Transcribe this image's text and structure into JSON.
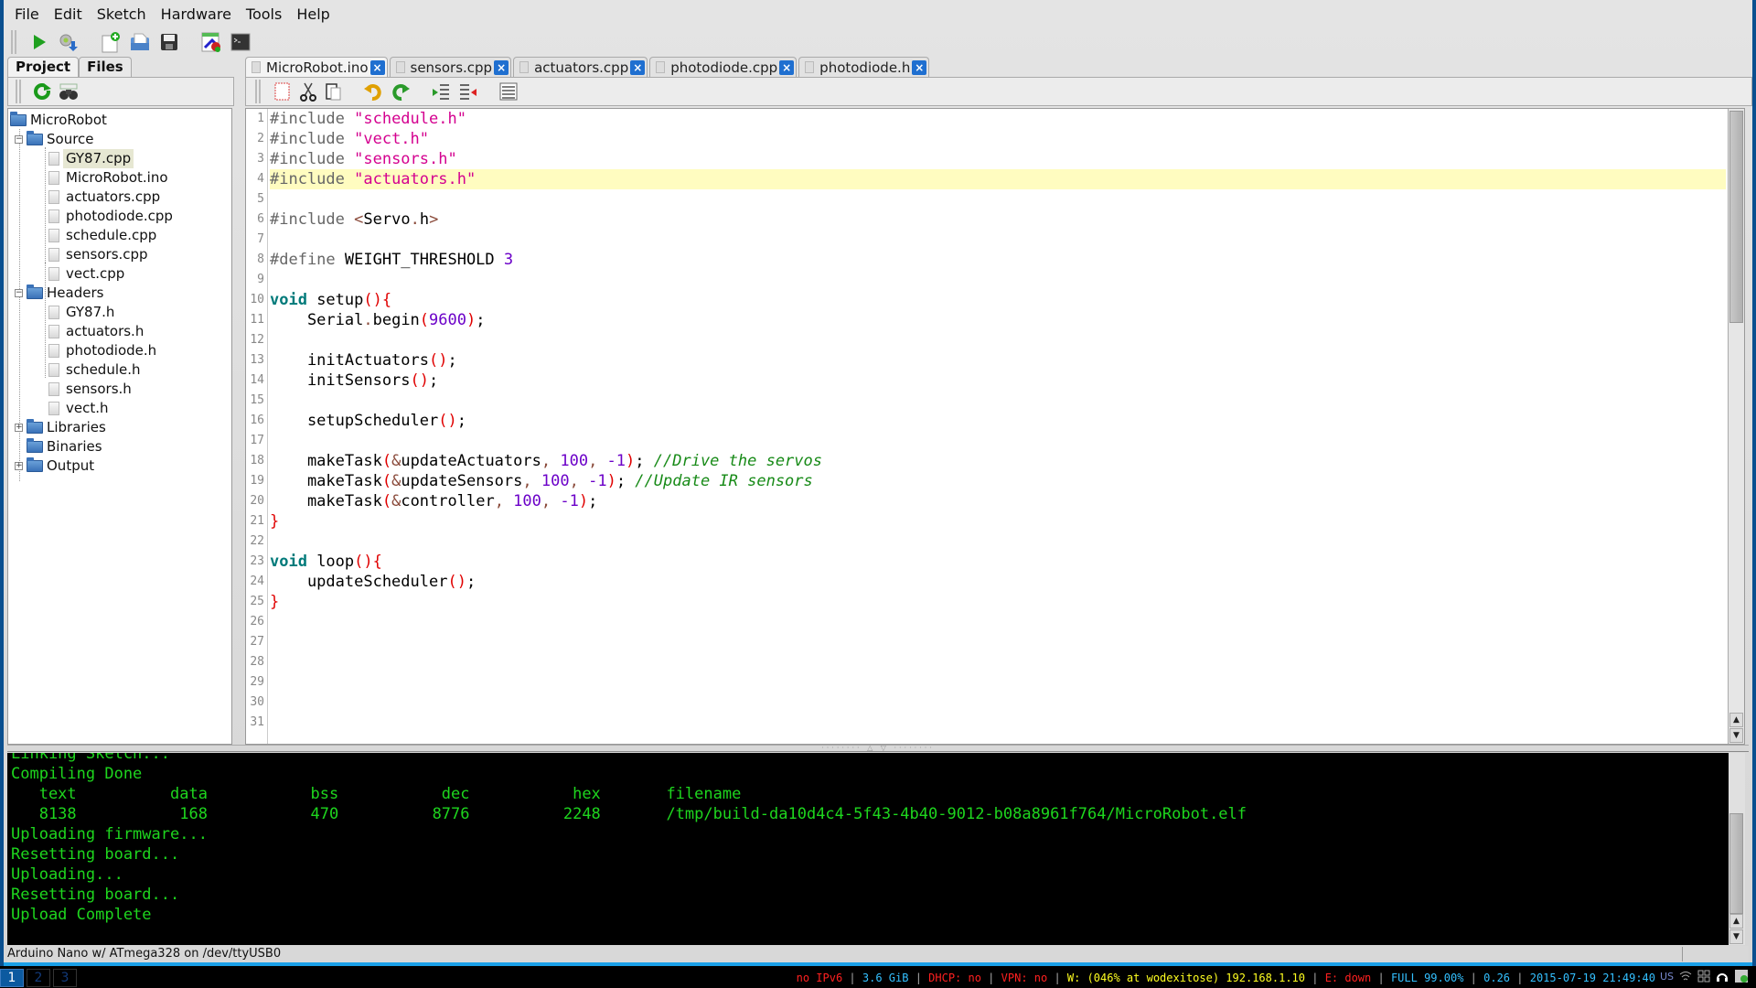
{
  "menu": [
    "File",
    "Edit",
    "Sketch",
    "Hardware",
    "Tools",
    "Help"
  ],
  "toolbar": {
    "icons": [
      "run-icon",
      "upload-icon",
      "new-file-icon",
      "open-folder-icon",
      "save-icon",
      "serial-plotter-icon",
      "terminal-icon"
    ]
  },
  "left_panel": {
    "tabs": [
      "Project",
      "Files"
    ],
    "active_tab": "Project",
    "tree": {
      "root": "MicroRobot",
      "source_label": "Source",
      "source_files": [
        "GY87.cpp",
        "MicroRobot.ino",
        "actuators.cpp",
        "photodiode.cpp",
        "schedule.cpp",
        "sensors.cpp",
        "vect.cpp"
      ],
      "selected": "GY87.cpp",
      "headers_label": "Headers",
      "header_files": [
        "GY87.h",
        "actuators.h",
        "photodiode.h",
        "schedule.h",
        "sensors.h",
        "vect.h"
      ],
      "libraries_label": "Libraries",
      "binaries_label": "Binaries",
      "output_label": "Output"
    }
  },
  "editor": {
    "tabs": [
      "MicroRobot.ino",
      "sensors.cpp",
      "actuators.cpp",
      "photodiode.cpp",
      "photodiode.h"
    ],
    "active_tab": "MicroRobot.ino",
    "highlighted_line": 4,
    "line_count": 31,
    "lines": [
      [
        [
          "pp",
          "#include "
        ],
        [
          "str",
          "\"schedule.h\""
        ]
      ],
      [
        [
          "pp",
          "#include "
        ],
        [
          "str",
          "\"vect.h\""
        ]
      ],
      [
        [
          "pp",
          "#include "
        ],
        [
          "str",
          "\"sensors.h\""
        ]
      ],
      [
        [
          "pp",
          "#include "
        ],
        [
          "str",
          "\"actuators.h\""
        ]
      ],
      [],
      [
        [
          "pp",
          "#include "
        ],
        [
          "ang",
          "<"
        ],
        [
          "",
          "Servo"
        ],
        [
          "ang",
          "."
        ],
        [
          "",
          "h"
        ],
        [
          "ang",
          ">"
        ]
      ],
      [],
      [
        [
          "pp",
          "#define "
        ],
        [
          "",
          "WEIGHT_THRESHOLD "
        ],
        [
          "num",
          "3"
        ]
      ],
      [],
      [
        [
          "kw",
          "void"
        ],
        [
          "",
          " setup"
        ],
        [
          "par",
          "(){"
        ]
      ],
      [
        [
          "",
          "    Serial"
        ],
        [
          "amp",
          "."
        ],
        [
          "",
          "begin"
        ],
        [
          "par",
          "("
        ],
        [
          "num",
          "9600"
        ],
        [
          "par",
          ")"
        ],
        [
          "",
          ";"
        ]
      ],
      [],
      [
        [
          "",
          "    initActuators"
        ],
        [
          "par",
          "()"
        ],
        [
          "",
          ";"
        ]
      ],
      [
        [
          "",
          "    initSensors"
        ],
        [
          "par",
          "()"
        ],
        [
          "",
          ";"
        ]
      ],
      [],
      [
        [
          "",
          "    setupScheduler"
        ],
        [
          "par",
          "()"
        ],
        [
          "",
          ";"
        ]
      ],
      [],
      [
        [
          "",
          "    makeTask"
        ],
        [
          "par",
          "("
        ],
        [
          "amp",
          "&"
        ],
        [
          "",
          "updateActuators"
        ],
        [
          "amp",
          ", "
        ],
        [
          "num",
          "100"
        ],
        [
          "amp",
          ", "
        ],
        [
          "num",
          "-1"
        ],
        [
          "par",
          ")"
        ],
        [
          "",
          "; "
        ],
        [
          "cm",
          "//Drive the servos"
        ]
      ],
      [
        [
          "",
          "    makeTask"
        ],
        [
          "par",
          "("
        ],
        [
          "amp",
          "&"
        ],
        [
          "",
          "updateSensors"
        ],
        [
          "amp",
          ", "
        ],
        [
          "num",
          "100"
        ],
        [
          "amp",
          ", "
        ],
        [
          "num",
          "-1"
        ],
        [
          "par",
          ")"
        ],
        [
          "",
          "; "
        ],
        [
          "cm",
          "//Update IR sensors"
        ]
      ],
      [
        [
          "",
          "    makeTask"
        ],
        [
          "par",
          "("
        ],
        [
          "amp",
          "&"
        ],
        [
          "",
          "controller"
        ],
        [
          "amp",
          ", "
        ],
        [
          "num",
          "100"
        ],
        [
          "amp",
          ", "
        ],
        [
          "num",
          "-1"
        ],
        [
          "par",
          ")"
        ],
        [
          "",
          ";"
        ]
      ],
      [
        [
          "par",
          "}"
        ]
      ],
      [],
      [
        [
          "kw",
          "void"
        ],
        [
          "",
          " loop"
        ],
        [
          "par",
          "(){"
        ]
      ],
      [
        [
          "",
          "    updateScheduler"
        ],
        [
          "par",
          "()"
        ],
        [
          "",
          ";"
        ]
      ],
      [
        [
          "par",
          "}"
        ]
      ],
      [],
      [],
      [],
      [],
      [],
      []
    ]
  },
  "console": {
    "partial_top": "Linking Sketch...",
    "lines": [
      "Compiling Done",
      "   text          data           bss           dec           hex       filename",
      "   8138           168           470          8776          2248       /tmp/build-da10d4c4-5f43-4b40-9012-b08a8961f764/MicroRobot.elf",
      "Uploading firmware...",
      "Resetting board...",
      "Uploading...",
      "Resetting board...",
      "Upload Complete"
    ]
  },
  "status_bar": "Arduino Nano w/ ATmega328 on /dev/ttyUSB0",
  "taskbar": {
    "workspaces": [
      "1",
      "2",
      "3"
    ],
    "active_workspace": "1",
    "sysinfo": [
      {
        "text": "no IPv6",
        "color": "#ff2020"
      },
      {
        "text": " | ",
        "color": "#aaaaaa"
      },
      {
        "text": "3.6 GiB",
        "color": "#33c0ff"
      },
      {
        "text": " | ",
        "color": "#aaaaaa"
      },
      {
        "text": "DHCP: no",
        "color": "#ff2020"
      },
      {
        "text": " | ",
        "color": "#aaaaaa"
      },
      {
        "text": "VPN: no",
        "color": "#ff2020"
      },
      {
        "text": " | ",
        "color": "#aaaaaa"
      },
      {
        "text": "W: (046% at wodexitose) 192.168.1.10",
        "color": "#ffff20"
      },
      {
        "text": " | ",
        "color": "#aaaaaa"
      },
      {
        "text": "E: down",
        "color": "#ff2020"
      },
      {
        "text": " | ",
        "color": "#aaaaaa"
      },
      {
        "text": "FULL 99.00%",
        "color": "#33c0ff"
      },
      {
        "text": " | ",
        "color": "#aaaaaa"
      },
      {
        "text": "0.26",
        "color": "#33c0ff"
      },
      {
        "text": " | ",
        "color": "#aaaaaa"
      },
      {
        "text": "2015-07-19 21:49:40",
        "color": "#33c0ff"
      }
    ],
    "keyboard_layout": "US"
  }
}
